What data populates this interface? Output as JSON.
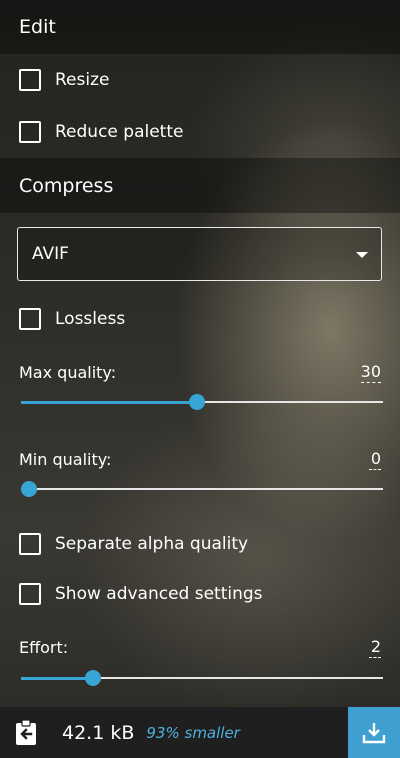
{
  "edit": {
    "title": "Edit",
    "options": [
      {
        "label": "Resize",
        "checked": false
      },
      {
        "label": "Reduce palette",
        "checked": false
      }
    ]
  },
  "compress": {
    "title": "Compress",
    "format": {
      "selected": "AVIF"
    },
    "lossless": {
      "label": "Lossless",
      "checked": false
    },
    "max_quality": {
      "label": "Max quality:",
      "value": "30",
      "min": 0,
      "max": 63,
      "fraction": 0.485
    },
    "min_quality": {
      "label": "Min quality:",
      "value": "0",
      "min": 0,
      "max": 63,
      "fraction": 0.0
    },
    "separate_alpha": {
      "label": "Separate alpha quality",
      "checked": false
    },
    "advanced": {
      "label": "Show advanced settings",
      "checked": false
    },
    "effort": {
      "label": "Effort:",
      "value": "2",
      "min": 0,
      "max": 10,
      "fraction": 0.2
    }
  },
  "footer": {
    "size": "42.1 kB",
    "savings": "93% smaller"
  },
  "colors": {
    "accent": "#37a6d6",
    "download_bg": "#3e9fd0",
    "savings_text": "#4fb1de"
  }
}
